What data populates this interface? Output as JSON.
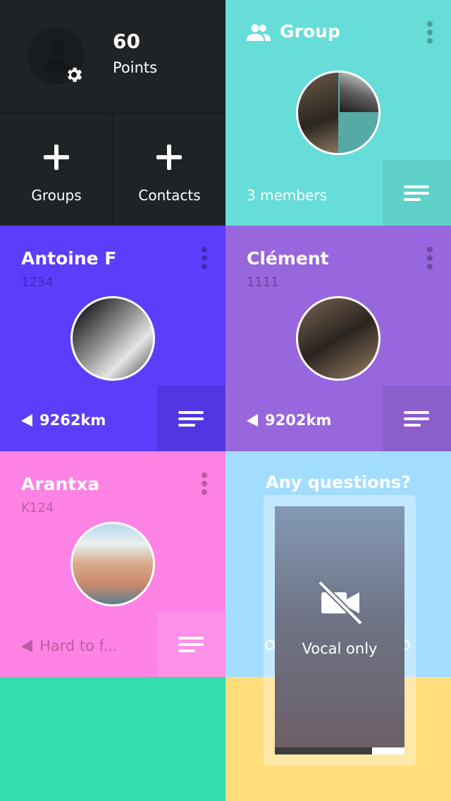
{
  "profile": {
    "points_value": "60",
    "points_label": "Points"
  },
  "actions": [
    {
      "label": "Groups"
    },
    {
      "label": "Contacts"
    }
  ],
  "group": {
    "title": "Group",
    "members": "3 members"
  },
  "contacts": [
    {
      "name": "Antoine F",
      "code": "1234",
      "distance": "9262km"
    },
    {
      "name": "Clément",
      "code": "1111",
      "distance": "9202km"
    },
    {
      "name": "Arantxa",
      "code": "K124",
      "distance": "Hard to f..."
    }
  ],
  "call": {
    "question": "Any questions?",
    "mode_label": "Vocal only",
    "progress": 0.25
  },
  "colors": {
    "dark": "#1f2326",
    "teal": "#66ddd8",
    "indigo": "#5b3dfb",
    "purple": "#9866dd",
    "pink": "#ff82e5",
    "sky": "#a2ddff",
    "mint": "#33ddae",
    "yellow": "#ffdd7b"
  },
  "icons": [
    "settings-gear-icon",
    "plus-icon",
    "group-people-icon",
    "more-vertical-icon",
    "list-lines-icon",
    "location-arrow-icon",
    "video-off-icon"
  ]
}
